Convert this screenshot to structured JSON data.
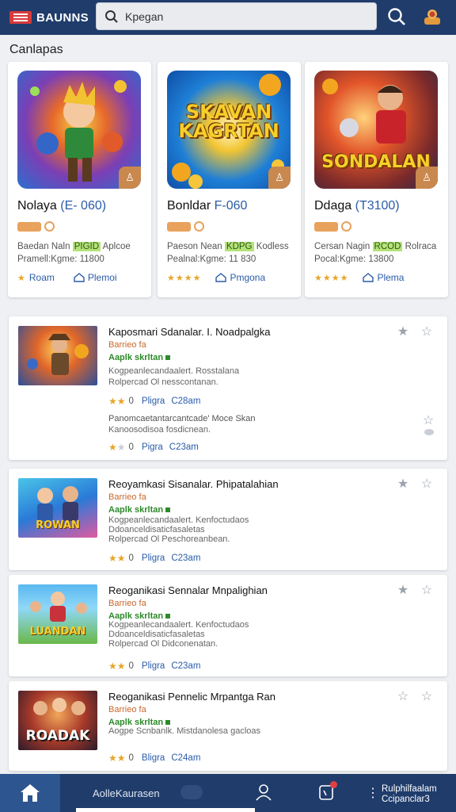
{
  "header": {
    "logo_text": "BAUNNS",
    "search_value": "Kpegan",
    "colors": {
      "bar": "#1f3c6b",
      "logo": "#d83a3a"
    }
  },
  "section_title": "Canlapas",
  "featured": [
    {
      "name": "Nolaya",
      "price": "(E- 060)",
      "art_title": "",
      "desc_a": "Baedan Naln",
      "desc_badge": "PIGID",
      "desc_b": "Aplcoe",
      "desc_c": "Pramell:Kgme: 11800",
      "platform": "Roam",
      "icon": "tag-icon"
    },
    {
      "name": "Bonldar",
      "price": "F-060",
      "art_title": "SKAVAN KAGRTAN",
      "desc_a": "Paeson Nean",
      "desc_badge": "KDPG",
      "desc_b": "Kodless",
      "desc_c": "Pealnal:Kgme: 11 830",
      "platform": "Pmgona",
      "icon": "tag-icon"
    },
    {
      "name": "Ddaga",
      "price": "(T3100)",
      "art_title": "SONDALAN",
      "desc_a": "Cersan Nagin",
      "desc_badge": "RCOD",
      "desc_b": "Rolraca",
      "desc_c": "Pocal:Kgme: 13800",
      "platform": "Plema",
      "icon": "tag-icon"
    }
  ],
  "list": [
    {
      "title": "Kaposmari Sdanalar. I. Noadpalgka",
      "orange": "Barrieo fa",
      "green": "Aaplk skrltan",
      "line1": "Kogpeanlecandaalert. Rosstalana",
      "line2": "Rolpercad Ol nesscontanan.",
      "rating_num": "0",
      "link": "Pligra",
      "time": "C28am",
      "extra1": "Panomcaetantarcantcade' Moce Skan",
      "extra2": "Kanoosodisoa fosdicnean.",
      "extra_rating_num": "0",
      "extra_link": "Pigra",
      "extra_time": "C23am",
      "thumb_text": ""
    },
    {
      "title": "Reoyamkasi Sisanalar. Phipatalahian",
      "orange": "Barrieo fa",
      "green": "Aaplk skrltan",
      "line1": "Kogpeanlecandaalert. Kenfoctudaos",
      "line2": "Ddoanceldisaticfasaletas",
      "line3": "Rolpercad Ol Peschoreanbean.",
      "rating_num": "0",
      "link": "Pligra",
      "time": "C23am",
      "thumb_text": "ROWAN"
    },
    {
      "title": "Reoganikasi Sennalar Mnpalighian",
      "orange": "Barrieo fa",
      "green": "Aaplk skrltan",
      "line1": "Kogpeanlecandaalert. Kenfoctudaos",
      "line2": "Ddoanceldisaticfasaletas",
      "line3": "Rolpercad Ol Didconenatan.",
      "rating_num": "0",
      "link": "Pligra",
      "time": "C23am",
      "thumb_text": "LUANDAN"
    },
    {
      "title": "Reoganikasi Pennelic Mrpantga Ran",
      "orange": "Barrieo fa",
      "green": "Aaplk skrltan",
      "line1": "Aogpe Scnbanlk. Mistdanolesa gacloas",
      "rating_num": "0",
      "link": "Bligra",
      "time": "C24am",
      "thumb_text": "ROADAK"
    }
  ],
  "bottom_nav": {
    "label": "AolleKaurasen",
    "right_line1": "Rulphilfaalam",
    "right_line2": "Ccipanclar3"
  }
}
